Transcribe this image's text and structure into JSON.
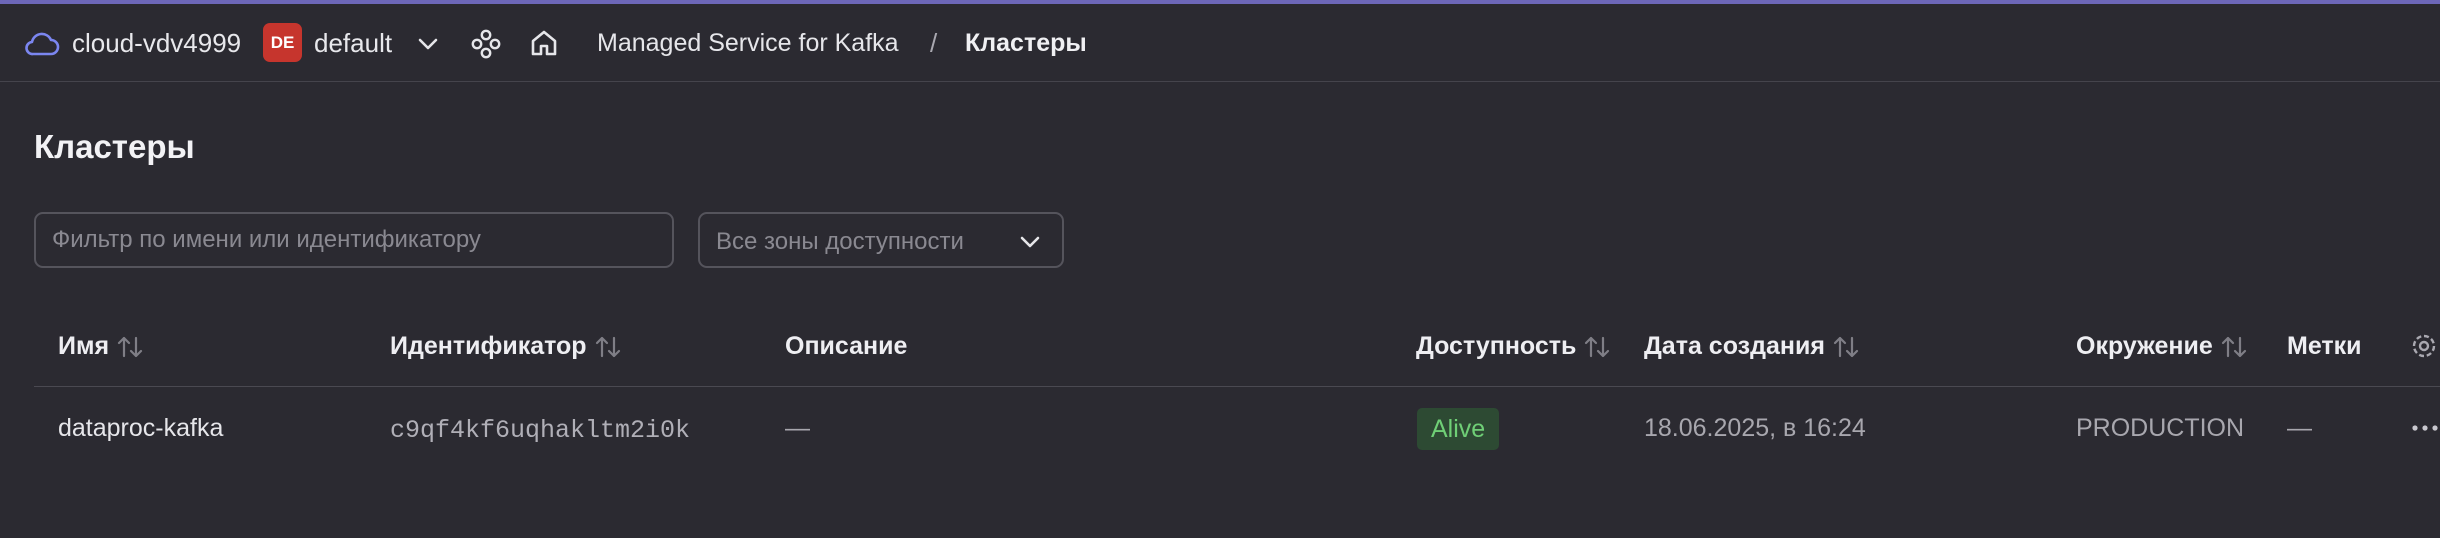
{
  "header": {
    "cloud_name": "cloud-vdv4999",
    "folder_badge": "DE",
    "folder_name": "default",
    "breadcrumb_service": "Managed Service for Kafka",
    "breadcrumb_separator": "/",
    "breadcrumb_current": "Кластеры",
    "icons": [
      "cloud-icon",
      "chevron-down-icon",
      "services-icon",
      "home-icon"
    ]
  },
  "page": {
    "title": "Кластеры"
  },
  "filters": {
    "search_placeholder": "Фильтр по имени или идентификатору",
    "search_value": "",
    "zone_select_label": "Все зоны доступности"
  },
  "table": {
    "columns": {
      "name": "Имя",
      "id": "Идентификатор",
      "description": "Описание",
      "availability": "Доступность",
      "created": "Дата создания",
      "environment": "Окружение",
      "labels": "Метки"
    },
    "rows": [
      {
        "name": "dataproc-kafka",
        "id": "c9qf4kf6uqhakltm2i0k",
        "description": "—",
        "availability": "Alive",
        "created": "18.06.2025, в 16:24",
        "environment": "PRODUCTION",
        "labels": "—"
      }
    ]
  },
  "colors": {
    "background": "#2b2a31",
    "accent_line": "#6d67b8",
    "folder_badge": "#c6352d",
    "status_alive_bg": "#2d4a33",
    "status_alive_text": "#6fcf76"
  }
}
